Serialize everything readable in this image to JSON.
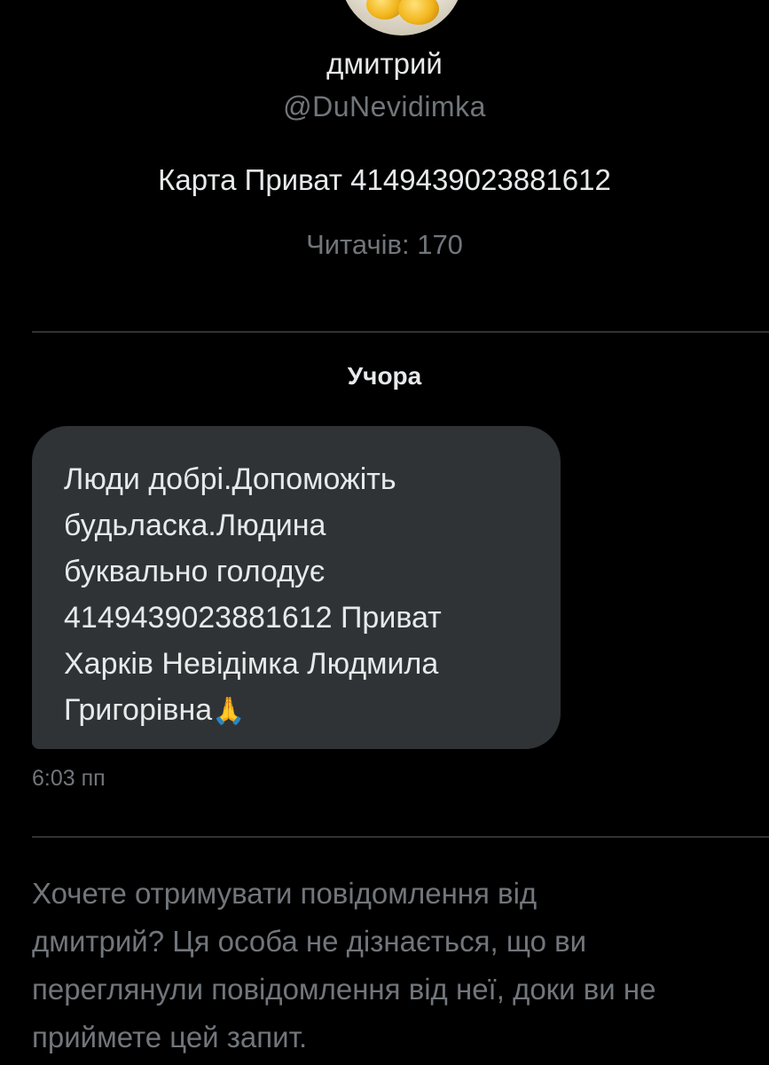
{
  "profile": {
    "avatar_icon": "profile-avatar-photo",
    "name": "дмитрий",
    "handle": "@DuNevidimka",
    "bio": "Карта Приват 4149439023881612",
    "followers": "Читачів: 170"
  },
  "conversation": {
    "date_label": "Учора",
    "message": {
      "lines": [
        "Люди добрі.Допоможіть",
        "будьласка.Людина",
        "буквально голодує",
        "4149439023881612 Приват",
        "Харків Невідімка Людмила",
        "Григорівна"
      ],
      "emoji": "🙏",
      "time": "6:03 пп"
    }
  },
  "request_prompt": {
    "lines": [
      "Хочете отримувати повідомлення від",
      "дмитрий? Ця особа не дізнається, що ви",
      "переглянули повідомлення від неї, доки ви не",
      "приймете цей запит."
    ]
  },
  "colors": {
    "background": "#000000",
    "primary_text": "#e7e9ea",
    "secondary_text": "#71767b",
    "bubble": "#2f3336",
    "divider": "#2f3336"
  }
}
